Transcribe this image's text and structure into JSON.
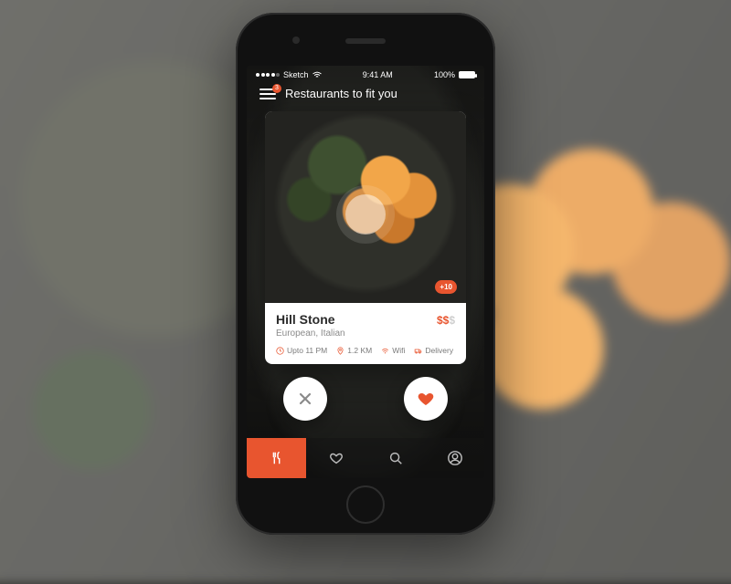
{
  "statusbar": {
    "carrier": "Sketch",
    "time": "9:41 AM",
    "battery": "100%"
  },
  "header": {
    "title": "Restaurants to fit you",
    "notification_badge": "3"
  },
  "card": {
    "photo_count_badge": "+10",
    "name": "Hill Stone",
    "price_tier_active": "$$",
    "price_tier_inactive": "$",
    "cuisine": "European, Italian",
    "meta": {
      "hours": "Upto 11 PM",
      "distance": "1.2 KM",
      "wifi": "Wifi",
      "delivery": "Delivery"
    }
  },
  "actions": {
    "dismiss": "Dismiss",
    "like": "Like"
  },
  "tabs": {
    "discover": "Discover",
    "favorites": "Favorites",
    "search": "Search",
    "profile": "Profile"
  }
}
